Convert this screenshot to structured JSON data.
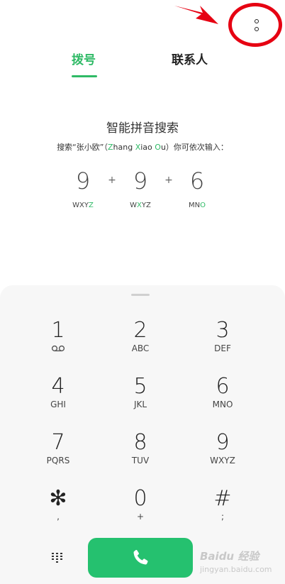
{
  "tabs": {
    "dial": "拨号",
    "contacts": "联系人"
  },
  "tip": {
    "title": "智能拼音搜索",
    "desc_prefix": "搜索“张小欧”（",
    "z": "Z",
    "hang": "hang ",
    "x": "X",
    "iao": "iao ",
    "o": "O",
    "u": "u",
    "desc_suffix": "）你可依次输入："
  },
  "example": {
    "d1": "9",
    "l1a": "WXY",
    "l1b": "Z",
    "plus1": "+",
    "d2": "9",
    "l2a": "W",
    "l2b": "X",
    "l2c": "YZ",
    "plus2": "+",
    "d3": "6",
    "l3a": "MN",
    "l3b": "O"
  },
  "keys": [
    {
      "num": "1",
      "sub": ""
    },
    {
      "num": "2",
      "sub": "ABC"
    },
    {
      "num": "3",
      "sub": "DEF"
    },
    {
      "num": "4",
      "sub": "GHI"
    },
    {
      "num": "5",
      "sub": "JKL"
    },
    {
      "num": "6",
      "sub": "MNO"
    },
    {
      "num": "7",
      "sub": "PQRS"
    },
    {
      "num": "8",
      "sub": "TUV"
    },
    {
      "num": "9",
      "sub": "WXYZ"
    },
    {
      "num": "✻",
      "sub": ","
    },
    {
      "num": "0",
      "sub": "+"
    },
    {
      "num": "#",
      "sub": ";"
    }
  ],
  "watermark": {
    "logo": "Baidu 经验",
    "sub": "jingyan.baidu.com"
  },
  "colors": {
    "accent": "#2fba66",
    "call": "#25c16f",
    "annotation": "#e60012"
  }
}
